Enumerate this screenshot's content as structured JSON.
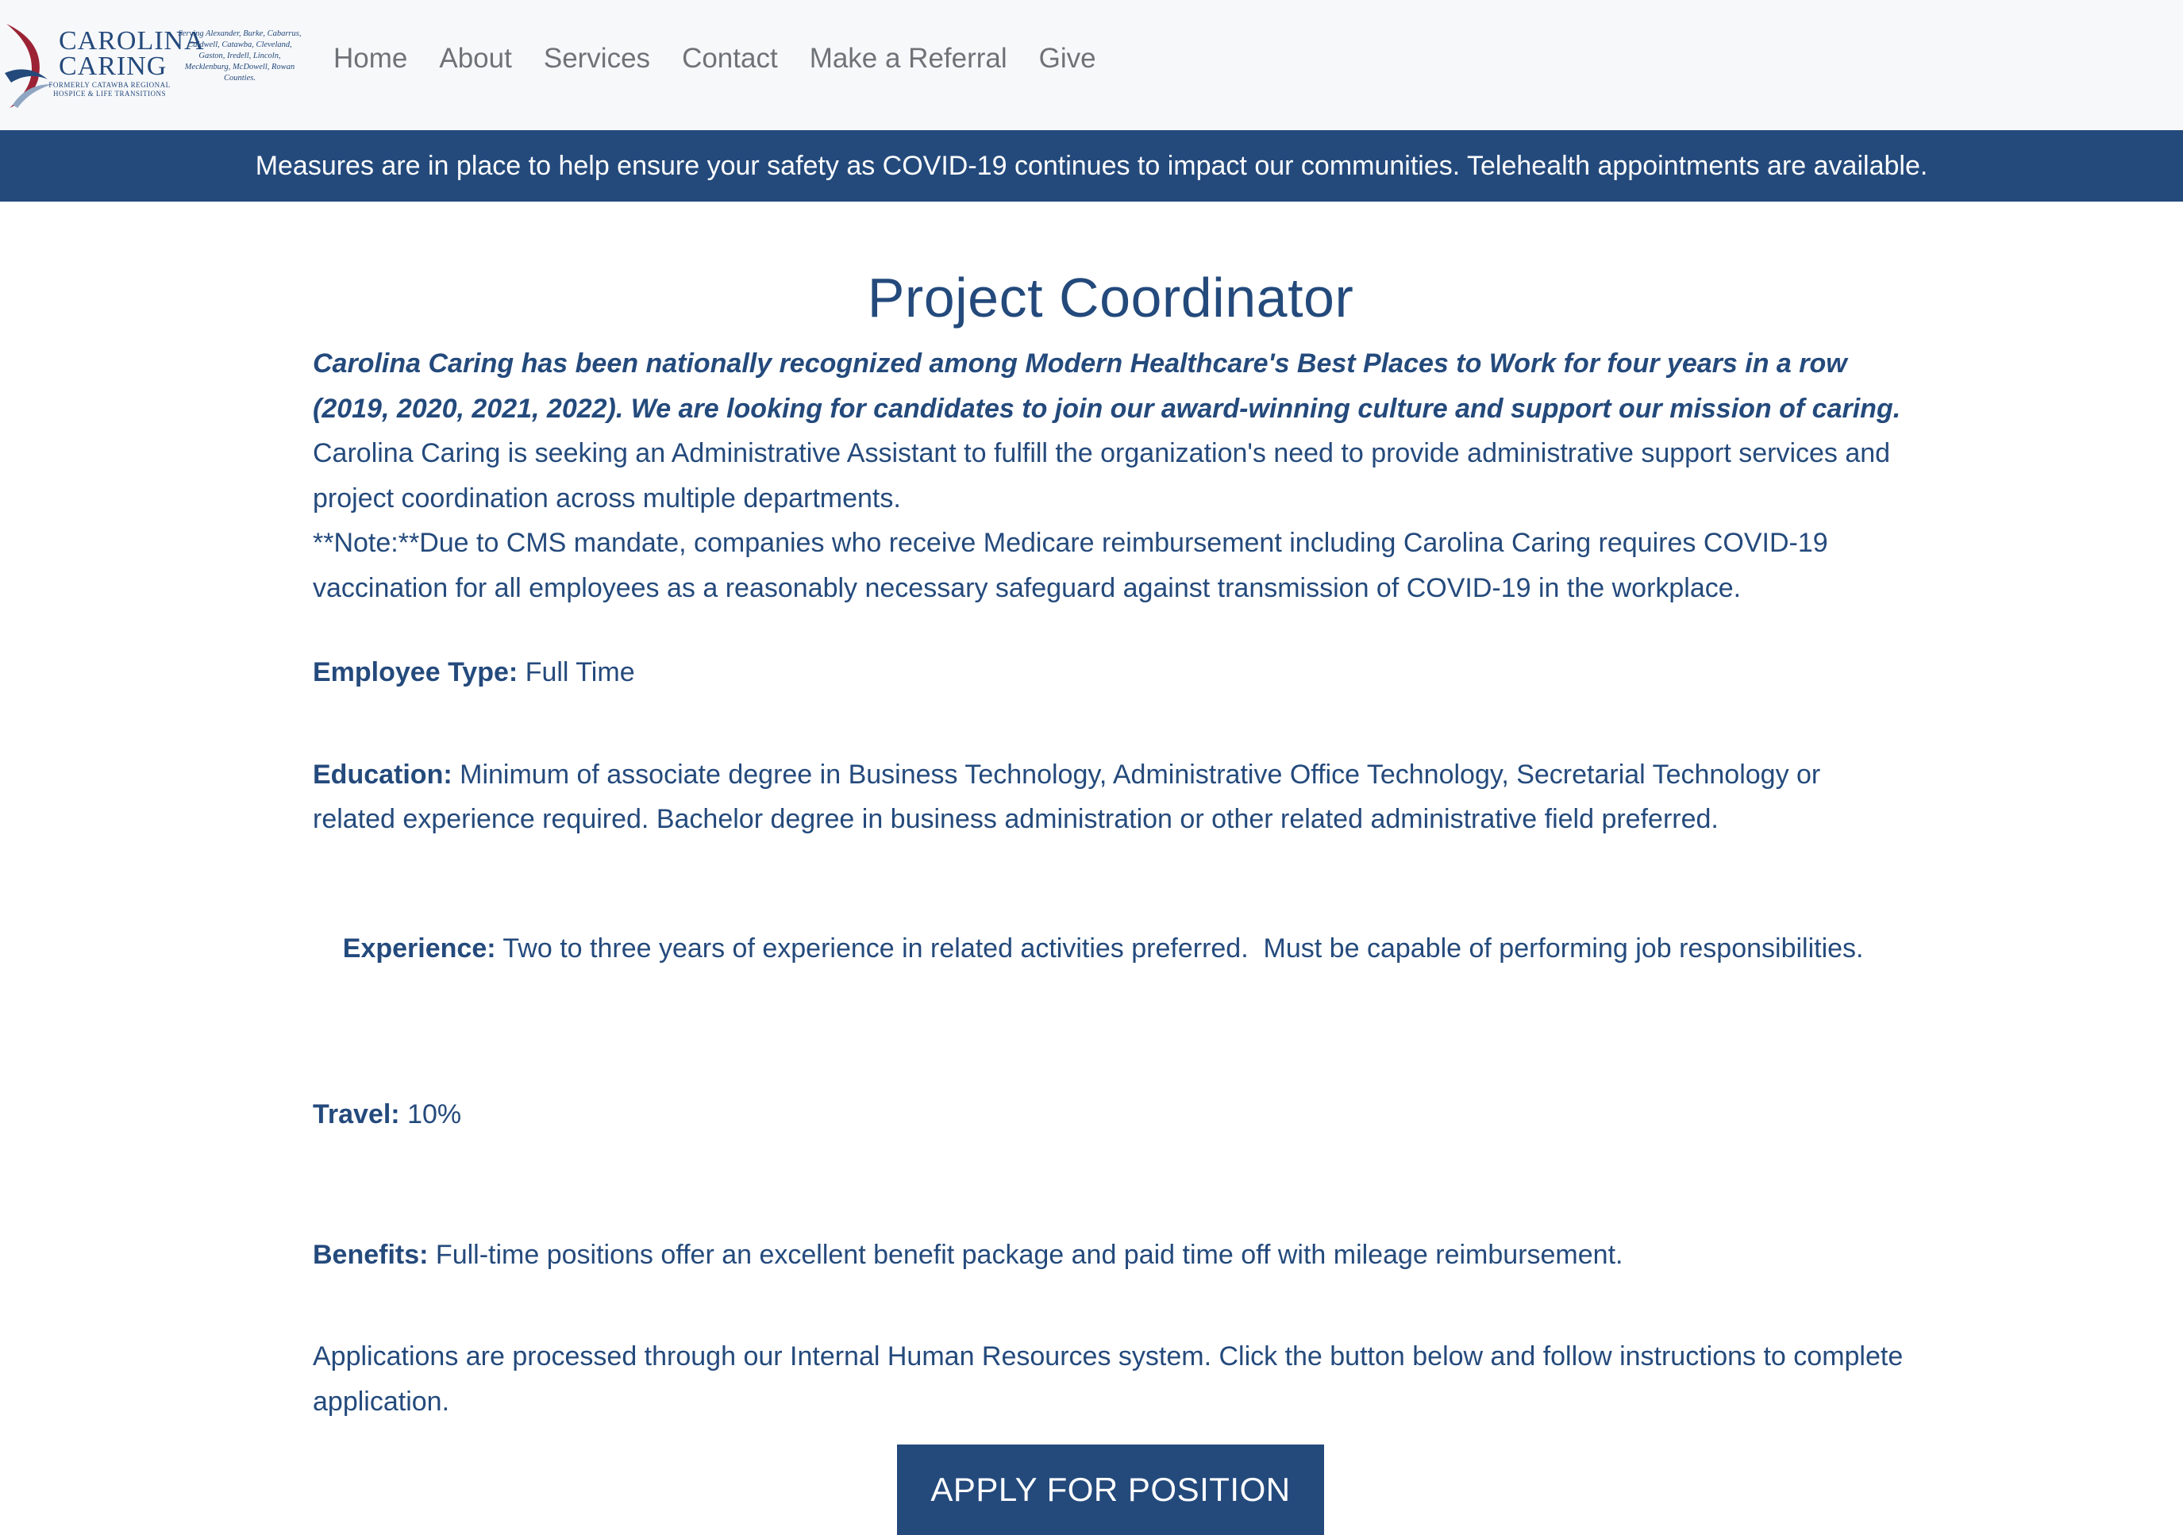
{
  "header": {
    "logo": {
      "name_line1": "Carolina",
      "name_line2": "Caring",
      "formerly": "Formerly Catawba Regional Hospice & Life Transitions",
      "serving": "Serving Alexander, Burke, Cabarrus, Caldwell, Catawba, Cleveland, Gaston, Iredell, Lincoln, Mecklenburg, McDowell, Rowan Counties."
    },
    "nav": [
      {
        "label": "Home"
      },
      {
        "label": "About"
      },
      {
        "label": "Services"
      },
      {
        "label": "Contact"
      },
      {
        "label": "Make a Referral"
      },
      {
        "label": "Give"
      }
    ]
  },
  "banner": {
    "text": "Measures are in place to help ensure your safety as COVID-19 continues to impact our communities. Telehealth appointments are available."
  },
  "job": {
    "title": "Project Coordinator",
    "intro_bold": "Carolina Caring has been nationally recognized among Modern Healthcare's Best Places to Work for four years in a row (2019, 2020, 2021, 2022). We are looking for candidates to join our award-winning culture and support our mission of caring.",
    "summary": "Carolina Caring is seeking an Administrative Assistant to fulfill the organization's need to provide administrative support services and project coordination across multiple departments.",
    "note": "**Note:**Due to CMS mandate, companies who receive Medicare reimbursement including Carolina Caring requires COVID-19 vaccination for all employees as a reasonably necessary safeguard against transmission of COVID-19 in the workplace.",
    "employee_type": {
      "label": "Employee Type:",
      "value": "Full Time"
    },
    "education": {
      "label": "Education:",
      "value": "Minimum of associate degree in Business Technology, Administrative Office Technology, Secretarial Technology or related experience required. Bachelor degree in business administration or other related administrative field preferred."
    },
    "experience": {
      "label": "Experience:",
      "value": "Two to three years of experience in related activities preferred.  Must be capable of performing job responsibilities."
    },
    "travel": {
      "label": "Travel:",
      "value": "10%"
    },
    "benefits": {
      "label": "Benefits:",
      "value": "Full-time positions offer an excellent benefit package and paid time off with mileage reimbursement."
    },
    "applications": "Applications are processed through our Internal Human Resources system. Click the button below and follow instructions to complete application.",
    "apply_label": "APPLY FOR POSITION"
  },
  "colors": {
    "brand_navy": "#244a7c",
    "header_bg": "#f7f8fa",
    "nav_text": "#6f7377",
    "logo_accent_red": "#9b2335"
  }
}
